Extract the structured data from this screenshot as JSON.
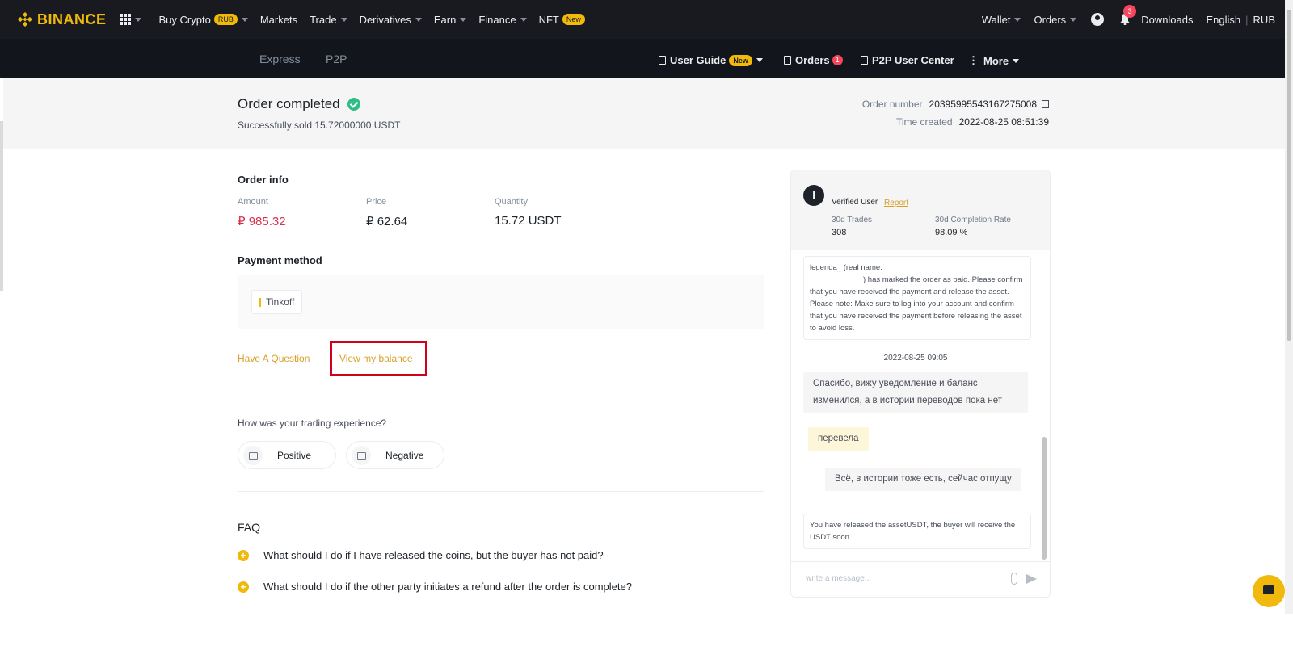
{
  "topnav": {
    "logo": "BINANCE",
    "items": [
      {
        "label": "Buy Crypto",
        "badge": "RUB"
      },
      {
        "label": "Markets"
      },
      {
        "label": "Trade"
      },
      {
        "label": "Derivatives"
      },
      {
        "label": "Earn"
      },
      {
        "label": "Finance"
      },
      {
        "label": "NFT",
        "badge": "New"
      }
    ],
    "right": {
      "wallet": "Wallet",
      "orders": "Orders",
      "notifications_count": "3",
      "downloads": "Downloads",
      "language": "English",
      "separator": "|",
      "currency": "RUB"
    }
  },
  "subnav": {
    "express": "Express",
    "p2p": "P2P",
    "user_guide": "User Guide",
    "user_guide_badge": "New",
    "orders": "Orders",
    "orders_count": "1",
    "p2p_user_center": "P2P User Center",
    "more": "More"
  },
  "order": {
    "title": "Order completed",
    "subtitle": "Successfully sold 15.72000000 USDT",
    "number_label": "Order number",
    "number": "20395995543167275008",
    "time_label": "Time created",
    "time": "2022-08-25 08:51:39"
  },
  "order_info": {
    "title": "Order info",
    "amount_label": "Amount",
    "amount": "₽ 985.32",
    "price_label": "Price",
    "price": "₽ 62.64",
    "quantity_label": "Quantity",
    "quantity": "15.72 USDT"
  },
  "payment": {
    "title": "Payment method",
    "method": "Tinkoff"
  },
  "links": {
    "question": "Have A Question",
    "balance": "View my balance"
  },
  "feedback": {
    "question": "How was your trading experience?",
    "positive": "Positive",
    "negative": "Negative"
  },
  "faq": {
    "title": "FAQ",
    "items": [
      "What should I do if I have released the coins, but the buyer has not paid?",
      "What should I do if the other party initiates a refund after the order is complete?"
    ]
  },
  "chat": {
    "avatar_letter": "l",
    "verified": "Verified User",
    "report": "Report",
    "trades_label": "30d Trades",
    "trades": "308",
    "completion_label": "30d Completion Rate",
    "completion": "98.09 %",
    "system_msg_line1": "legenda_ (real name:",
    "system_msg_line2": ") has marked the order as paid. Please confirm that you have received the payment and release the asset. Please note: Make sure to log into your account and confirm that you have received the payment before releasing the asset to avoid loss.",
    "timestamp": "2022-08-25 09:05",
    "msg1": "Спасибо, вижу уведомление и баланс изменился, а в истории переводов пока нет",
    "msg2": "перевела",
    "msg3": "Всё, в истории тоже есть, сейчас отпущу",
    "release_msg": "You have released the assetUSDT, the buyer will receive the USDT soon.",
    "input_placeholder": "write a message..."
  }
}
